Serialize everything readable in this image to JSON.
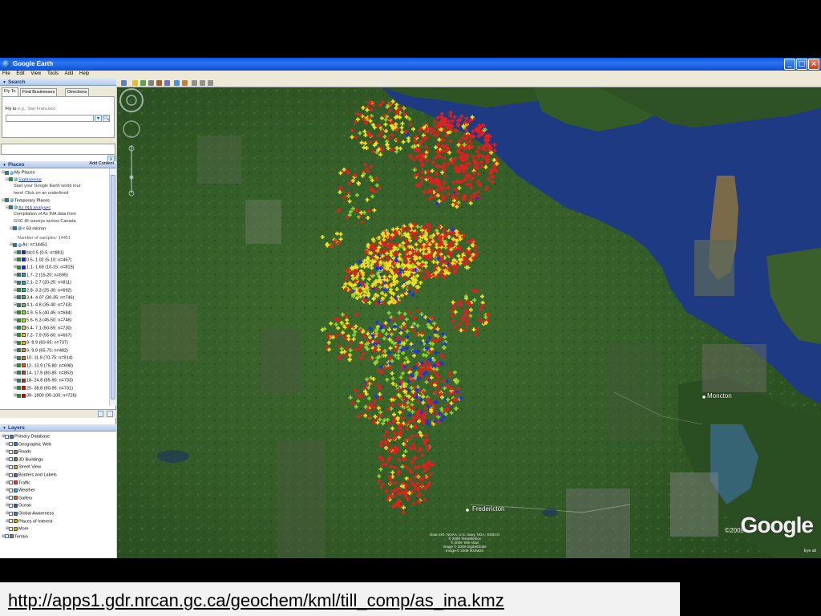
{
  "window": {
    "title": "Google Earth",
    "minimize_glyph": "_",
    "maximize_glyph": "□",
    "close_glyph": "×"
  },
  "menu": [
    "File",
    "Edit",
    "View",
    "Tools",
    "Add",
    "Help"
  ],
  "search": {
    "header": "Search",
    "tabs": [
      "Fly To",
      "Find Businesses",
      "Directions"
    ],
    "fly_to_label": "Fly to",
    "fly_to_example": "e.g., San Francisco",
    "go_glyph": "🔍",
    "close_glyph": "x"
  },
  "places": {
    "header": "Places",
    "add_content": "Add Content",
    "rows": [
      {
        "label": "My Places",
        "indent": 0,
        "checked": true
      },
      {
        "label": "Sightseeing",
        "indent": 1,
        "checked": true,
        "link": true
      },
      {
        "label": "Start your Google Earth world tour",
        "indent": 3,
        "desc": true
      },
      {
        "label": "here! Click on an underlined",
        "indent": 3,
        "desc": true
      },
      {
        "label": "Temporary Places",
        "indent": 0,
        "checked": true
      },
      {
        "label": "As INA analyses",
        "indent": 1,
        "checked": true,
        "link": true
      },
      {
        "label": "Compilation of As INA data from",
        "indent": 3,
        "desc": true
      },
      {
        "label": "GSC till surveys across Canada",
        "indent": 3,
        "desc": true
      },
      {
        "label": "< 63 micron",
        "indent": 2,
        "checked": true
      },
      {
        "label": "Number of samples: 14451",
        "indent": 4,
        "desc": true
      },
      {
        "label": "As: n=14451",
        "indent": 2,
        "checked": true
      }
    ],
    "classes": [
      {
        "label": "ltd;0.5 (0-5: n=881)",
        "color": "#2020e0"
      },
      {
        "label": "0.5- 1.02 (5-10: n=467)",
        "color": "#2020e0"
      },
      {
        "label": "1.1- 1.69 (10-15: n=815)",
        "color": "#2020e0"
      },
      {
        "label": "1.7- 2 (15-20: n=595)",
        "color": "#20a0e0"
      },
      {
        "label": "2.1- 2.7 (20-25: n=811)",
        "color": "#20a0e0"
      },
      {
        "label": "2.8- 3.3 (25-30: n=692)",
        "color": "#20c0a0"
      },
      {
        "label": "3.4- 4.07 (30-35: n=746)",
        "color": "#40c040"
      },
      {
        "label": "4.1- 4.8 (35-40: n=743)",
        "color": "#60d040"
      },
      {
        "label": "4.9- 5.5 (40-45: n=684)",
        "color": "#90e030"
      },
      {
        "label": "5.6- 6.3 (45-50: n=746)",
        "color": "#b0e020"
      },
      {
        "label": "6.4- 7.1 (50-55: n=730)",
        "color": "#e0e020"
      },
      {
        "label": "7.2- 7.9 (55-60: n=667)",
        "color": "#f0d020"
      },
      {
        "label": "8- 8.9 (60-65: n=737)",
        "color": "#f0b020"
      },
      {
        "label": "9- 9.9 (65-70: n=482)",
        "color": "#f09020"
      },
      {
        "label": "10- 11.9 (70-75: n=914)",
        "color": "#f07020"
      },
      {
        "label": "12- 13.9 (75-80: n=698)",
        "color": "#f05020"
      },
      {
        "label": "14- 17.9 (80-85: n=853)",
        "color": "#e03020"
      },
      {
        "label": "18- 24.8 (85-90: n=733)",
        "color": "#e02020"
      },
      {
        "label": "25- 38.8 (90-95: n=731)",
        "color": "#d01010"
      },
      {
        "label": "39- 1800 (95-100: n=726)",
        "color": "#c00000"
      }
    ]
  },
  "layers": {
    "header": "Layers",
    "items": [
      {
        "label": "Primary Database",
        "indent": 0,
        "icon": "globe-icon"
      },
      {
        "label": "Geographic Web",
        "indent": 1,
        "icon": "globe-icon"
      },
      {
        "label": "Roads",
        "indent": 1,
        "icon": "roads-icon"
      },
      {
        "label": "3D Buildings",
        "indent": 1,
        "icon": "buildings-icon"
      },
      {
        "label": "Street View",
        "indent": 1,
        "icon": "street-view-icon"
      },
      {
        "label": "Borders and Labels",
        "indent": 1,
        "icon": "borders-icon"
      },
      {
        "label": "Traffic",
        "indent": 1,
        "icon": "traffic-icon"
      },
      {
        "label": "Weather",
        "indent": 1,
        "icon": "weather-icon"
      },
      {
        "label": "Gallery",
        "indent": 1,
        "icon": "gallery-icon"
      },
      {
        "label": "Ocean",
        "indent": 1,
        "icon": "ocean-icon"
      },
      {
        "label": "Global Awareness",
        "indent": 1,
        "icon": "globe-icon"
      },
      {
        "label": "Places of Interest",
        "indent": 1,
        "icon": "poi-icon"
      },
      {
        "label": "More",
        "indent": 1,
        "icon": "folder-icon"
      },
      {
        "label": "Terrain",
        "indent": 0,
        "icon": "terrain-icon"
      }
    ]
  },
  "map": {
    "labels": {
      "moncton": "Moncton",
      "fredericton": "Fredericton"
    },
    "attribution": [
      "Data SIO, NOAA, U.S. Navy, NGA, GEBCO",
      "© 2009 TerraMetrics",
      "© 2009 Tele Atlas",
      "Image © 2009 DigitalGlobe",
      "Image © 2009 IKONOS"
    ],
    "copyright": "©2009",
    "logo": "Google",
    "eye_alt": "Eye alt"
  },
  "caption": {
    "url": "http://apps1.gdr.nrcan.gc.ca/geochem/kml/till_comp/as_ina.kmz"
  }
}
